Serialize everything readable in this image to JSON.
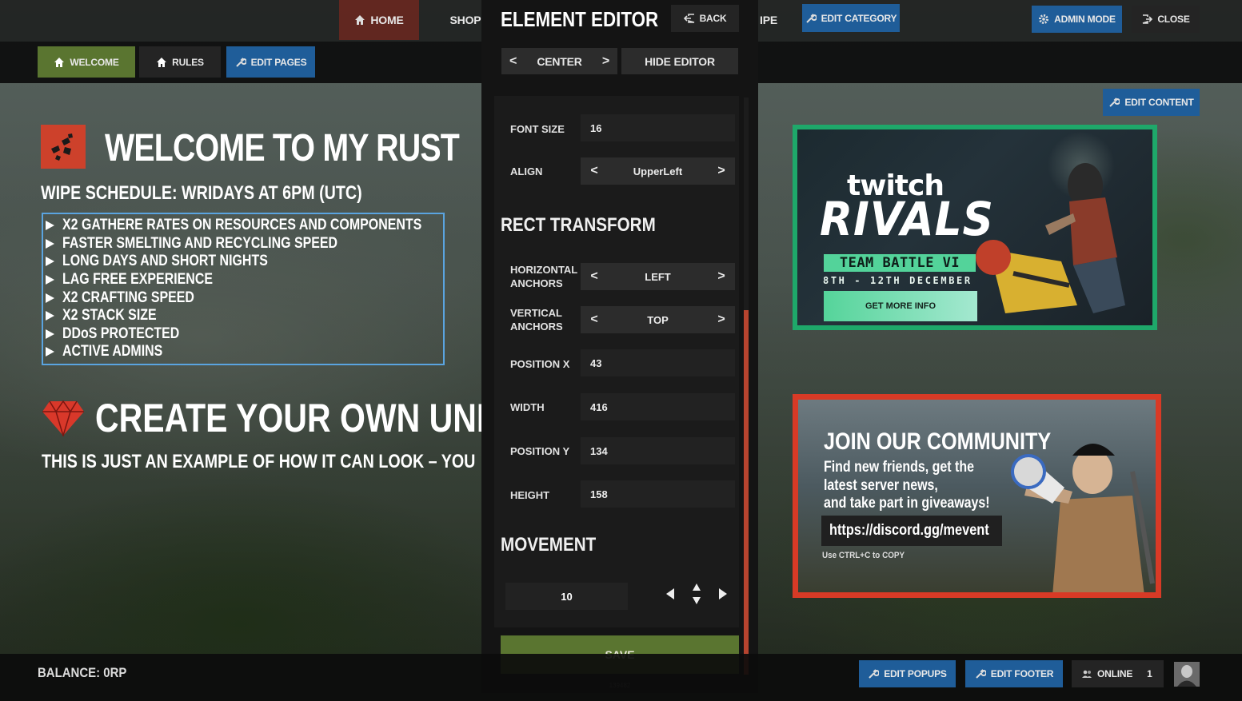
{
  "topbar": {
    "home": "HOME",
    "shop": "SHOP",
    "wipe": "IPE",
    "edit_category": "EDIT CATEGORY",
    "admin_mode": "ADMIN MODE",
    "close": "CLOSE"
  },
  "subbar": {
    "welcome": "WELCOME",
    "rules": "RULES",
    "edit_pages": "EDIT PAGES"
  },
  "editor": {
    "title": "ELEMENT EDITOR",
    "back": "BACK",
    "center": "CENTER",
    "hide_editor": "HIDE EDITOR",
    "font_size_label": "FONT SIZE",
    "font_size": "16",
    "align_label": "ALIGN",
    "align": "UpperLeft",
    "rect_transform": "RECT TRANSFORM",
    "h_anchors_label": "HORIZONTAL ANCHORS",
    "h_anchors": "LEFT",
    "v_anchors_label": "VERTICAL ANCHORS",
    "v_anchors": "TOP",
    "position_x_label": "POSITION X",
    "position_x": "43",
    "width_label": "WIDTH",
    "width": "416",
    "position_y_label": "POSITION Y",
    "position_y": "134",
    "height_label": "HEIGHT",
    "height": "158",
    "movement": "MOVEMENT",
    "step": "10",
    "save": "SAVE",
    "id": "139482"
  },
  "content": {
    "heading": "WELCOME TO MY RUST",
    "wipe_schedule": "WIPE SCHEDULE: WRIDAYS AT 6PM (UTC)",
    "rules": [
      "X2 GATHERE RATES ON RESOURCES AND COMPONENTS",
      "FASTER SMELTING AND RECYCLING SPEED",
      "LONG DAYS AND SHORT NIGHTS",
      "LAG FREE EXPERIENCE",
      "X2 CRAFTING SPEED",
      "X2 STACK SIZE",
      "DDoS PROTECTED",
      "ACTIVE ADMINS"
    ],
    "create_heading": "CREATE YOUR OWN UNIC",
    "example": "THIS IS JUST AN EXAMPLE OF HOW IT CAN LOOK – YOU"
  },
  "right": {
    "edit_content": "EDIT CONTENT",
    "twitch_word": "twitch",
    "rivals": "RIVALS",
    "team_battle": "TEAM BATTLE VI",
    "dates": "8TH - 12TH DECEMBER",
    "get_more_info": "GET MORE INFO",
    "community_title": "JOIN OUR COMMUNITY",
    "community_text": "Find new friends, get the\nlatest server news,\nand take part in giveaways!",
    "discord_link": "https://discord.gg/mevent",
    "copy_hint": "Use CTRL+C to COPY"
  },
  "bottom": {
    "balance": "BALANCE: 0RP",
    "edit_popups": "EDIT POPUPS",
    "edit_footer": "EDIT FOOTER",
    "online_label": "ONLINE",
    "online_count": "1"
  },
  "colors": {
    "accent_blue": "#1f5d99",
    "accent_green": "#5a7530",
    "rust_red": "#cd412b",
    "twitch_green": "#1ea86a",
    "rules_border": "#5aa4e0"
  },
  "icons": [
    "home-icon",
    "wrench-icon",
    "gear-icon",
    "exit-icon",
    "back-icon",
    "users-icon",
    "rust-logo-icon",
    "gem-icon"
  ]
}
